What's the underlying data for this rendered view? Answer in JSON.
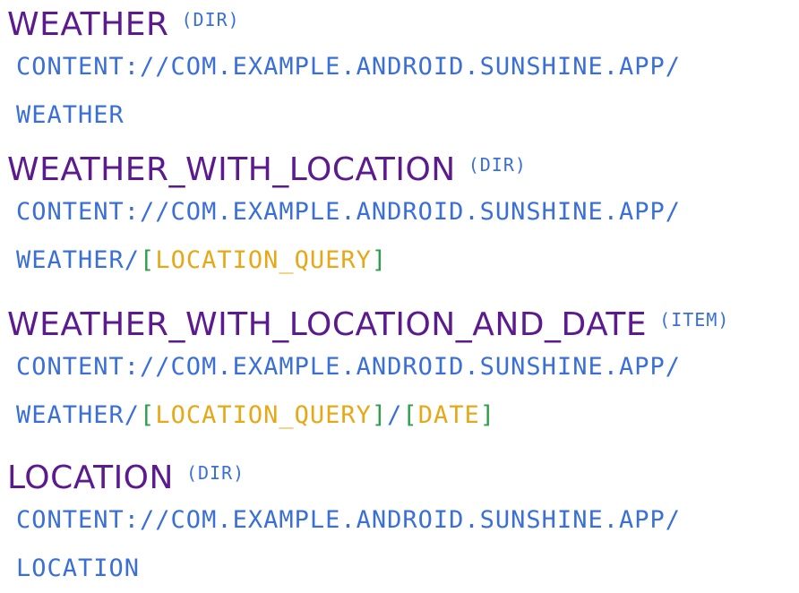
{
  "entries": [
    {
      "name": "WEATHER",
      "tag": "(DIR)",
      "uri_line1": "CONTENT://COM.EXAMPLE.ANDROID.SUNSHINE.APP/",
      "uri_line2_prefix": "WEATHER",
      "uri_line2_segments": []
    },
    {
      "name": "WEATHER_WITH_LOCATION",
      "tag": "(DIR)",
      "uri_line1": "CONTENT://COM.EXAMPLE.ANDROID.SUNSHINE.APP/",
      "uri_line2_prefix": "WEATHER/",
      "seg1_open": "[",
      "seg1_param": "LOCATION_QUERY",
      "seg1_close": "]"
    },
    {
      "name": "WEATHER_WITH_LOCATION_AND_DATE",
      "tag": "(ITEM)",
      "uri_line1": "CONTENT://COM.EXAMPLE.ANDROID.SUNSHINE.APP/",
      "uri_line2_prefix": "WEATHER/",
      "seg1_open": "[",
      "seg1_param": "LOCATION_QUERY",
      "seg1_close": "]",
      "sep": "/",
      "seg2_open": "[",
      "seg2_param": "DATE",
      "seg2_close": "]"
    },
    {
      "name": "LOCATION",
      "tag": "(DIR)",
      "uri_line1": "CONTENT://COM.EXAMPLE.ANDROID.SUNSHINE.APP/",
      "uri_line2_prefix": "LOCATION"
    }
  ],
  "colors": {
    "name": "#5b1a8e",
    "uri": "#3a6fd8",
    "bracket": "#2e9e4a",
    "param": "#e6a817"
  }
}
